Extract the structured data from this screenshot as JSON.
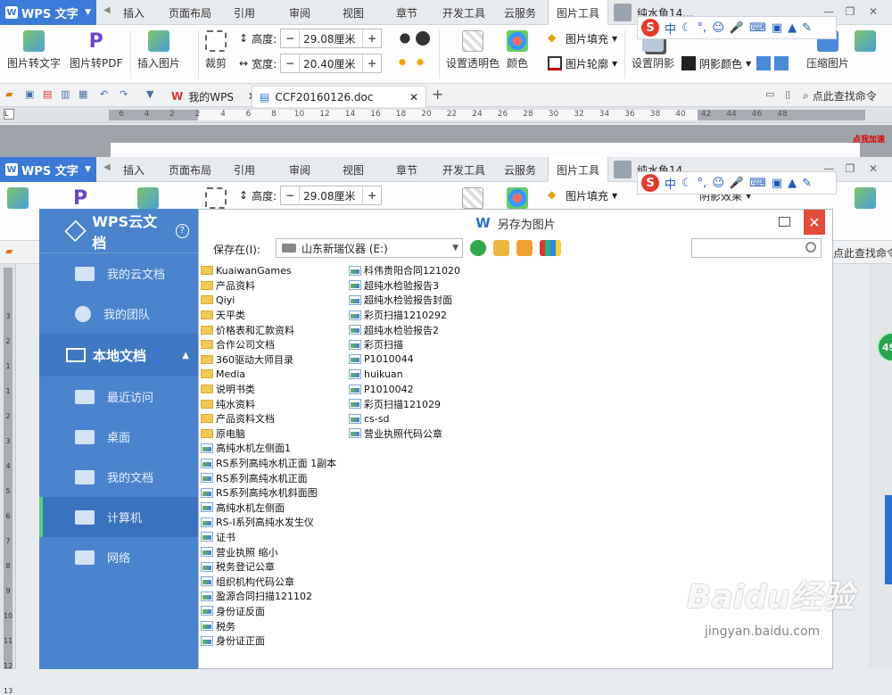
{
  "app": {
    "name": "WPS 文字"
  },
  "tabs": [
    "插入",
    "页面布局",
    "引用",
    "审阅",
    "视图",
    "章节",
    "开发工具",
    "云服务",
    "图片工具"
  ],
  "user": {
    "name": "纯水鱼14..."
  },
  "ribbon": {
    "pic_to_text": "图片转文字",
    "pic_to_pdf": "图片转PDF",
    "insert_pic": "插入图片",
    "crop": "裁剪",
    "height_label": "高度:",
    "height_value": "29.08厘米",
    "width_label": "宽度:",
    "width_value": "20.40厘米",
    "set_transparent": "设置透明色",
    "color": "颜色",
    "pic_fill": "图片填充",
    "pic_outline": "图片轮廓",
    "set_shadow": "设置阴影",
    "shadow_effect": "阴影效果",
    "shadow_color": "阴影颜色",
    "compress": "压缩图片",
    "ime_label": "中"
  },
  "doctabs": {
    "mywps": "我的WPS",
    "doc": "CCF20160126.doc",
    "search": "点此查找命令"
  },
  "ruler_numbers": [
    "6",
    "4",
    "2",
    "2",
    "4",
    "6",
    "8",
    "10",
    "12",
    "14",
    "16",
    "18",
    "20",
    "22",
    "24",
    "26",
    "28",
    "30",
    "32",
    "34",
    "36",
    "38",
    "40",
    "42",
    "44",
    "46",
    "48"
  ],
  "vruler_numbers": [
    "3",
    "2",
    "1",
    "1",
    "2",
    "3",
    "4",
    "5",
    "6",
    "7",
    "8",
    "9",
    "10",
    "11",
    "12",
    "13"
  ],
  "badge": {
    "right_ball": "49",
    "click_speed": "点我加速"
  },
  "cloud": {
    "title": "WPS云文档",
    "my_cloud": "我的云文档",
    "my_team": "我的团队",
    "local": "本地文档",
    "recent": "最近访问",
    "desktop": "桌面",
    "my_docs": "我的文档",
    "computer": "计算机",
    "network": "网络"
  },
  "dialog": {
    "title": "另存为图片",
    "save_in": "保存在(I):",
    "drive": "山东新瑞仪器 (E:)",
    "col1": [
      {
        "type": "folder",
        "name": "KuaiwanGames"
      },
      {
        "type": "folder",
        "name": "产品资料"
      },
      {
        "type": "folder",
        "name": "Qiyi"
      },
      {
        "type": "folder",
        "name": "天平类"
      },
      {
        "type": "folder",
        "name": "价格表和汇款资料"
      },
      {
        "type": "folder",
        "name": "合作公司文档"
      },
      {
        "type": "folder",
        "name": "360驱动大师目录"
      },
      {
        "type": "folder",
        "name": "Media"
      },
      {
        "type": "folder",
        "name": "说明书类"
      },
      {
        "type": "folder",
        "name": "纯水资料"
      },
      {
        "type": "folder",
        "name": "产品资料文档"
      },
      {
        "type": "folder",
        "name": "原电脑"
      },
      {
        "type": "image",
        "name": "高纯水机左侧面1"
      },
      {
        "type": "image",
        "name": "RS系列高纯水机正面 1副本"
      },
      {
        "type": "image",
        "name": "RS系列高纯水机正面"
      },
      {
        "type": "image",
        "name": "RS系列高纯水机斜面图"
      },
      {
        "type": "image",
        "name": "高纯水机左侧面"
      },
      {
        "type": "image",
        "name": "RS-Ⅰ系列高纯水发生仪"
      },
      {
        "type": "image",
        "name": "证书"
      },
      {
        "type": "image",
        "name": "营业执照 缩小"
      },
      {
        "type": "image",
        "name": "税务登记公章"
      },
      {
        "type": "image",
        "name": "组织机构代码公章"
      },
      {
        "type": "image",
        "name": "盈源合同扫描121102"
      },
      {
        "type": "image",
        "name": "身份证反面"
      },
      {
        "type": "image",
        "name": "税务"
      },
      {
        "type": "image",
        "name": "身份证正面"
      }
    ],
    "col2": [
      {
        "type": "image",
        "name": "科伟贵阳合同121020"
      },
      {
        "type": "image",
        "name": "超纯水检验报告3"
      },
      {
        "type": "image",
        "name": "超纯水检验报告封面"
      },
      {
        "type": "image",
        "name": "彩页扫描1210292"
      },
      {
        "type": "image",
        "name": "超纯水检验报告2"
      },
      {
        "type": "image",
        "name": "彩页扫描"
      },
      {
        "type": "image",
        "name": "P1010044"
      },
      {
        "type": "image",
        "name": "huikuan"
      },
      {
        "type": "image",
        "name": "P1010042"
      },
      {
        "type": "image",
        "name": "彩页扫描121029"
      },
      {
        "type": "image",
        "name": "cs-sd"
      },
      {
        "type": "image",
        "name": "营业执照代码公章"
      }
    ]
  },
  "watermark": {
    "logo": "Baidu经验",
    "url": "jingyan.baidu.com"
  }
}
